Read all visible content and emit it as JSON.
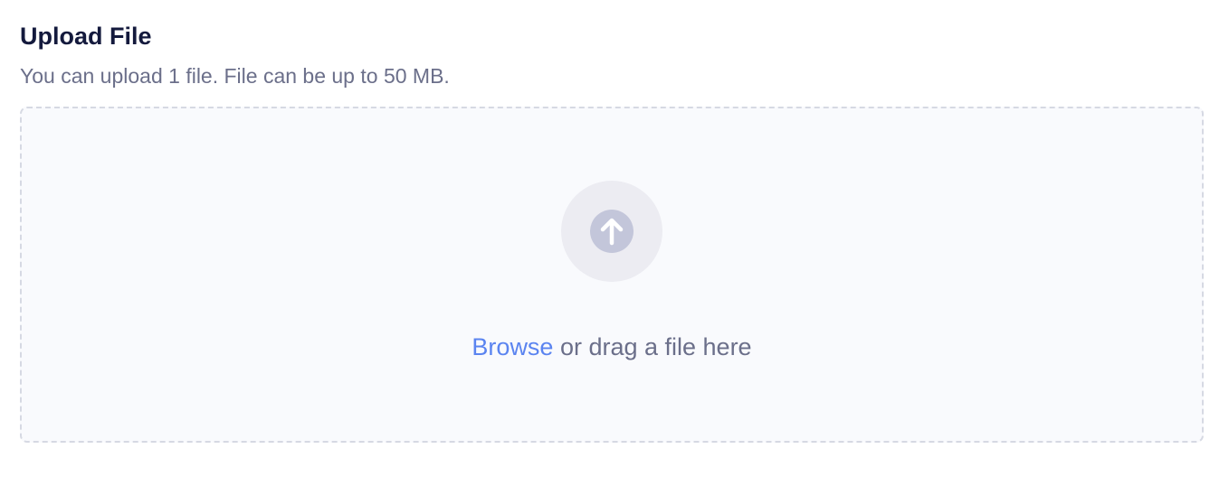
{
  "header": {
    "title": "Upload File",
    "subtitle": "You can upload 1 file. File can be up to 50 MB."
  },
  "dropzone": {
    "icon": "arrow-up-circle-icon",
    "browse_label": "Browse",
    "drag_text": " or drag a file here"
  },
  "colors": {
    "title": "#141a3d",
    "muted_text": "#6b6f8a",
    "link": "#5b84f0",
    "dropzone_bg": "#f9fafd",
    "dropzone_border": "#d6d9e3",
    "icon_circle": "#ececf2",
    "icon_fill": "#c3c6da"
  }
}
